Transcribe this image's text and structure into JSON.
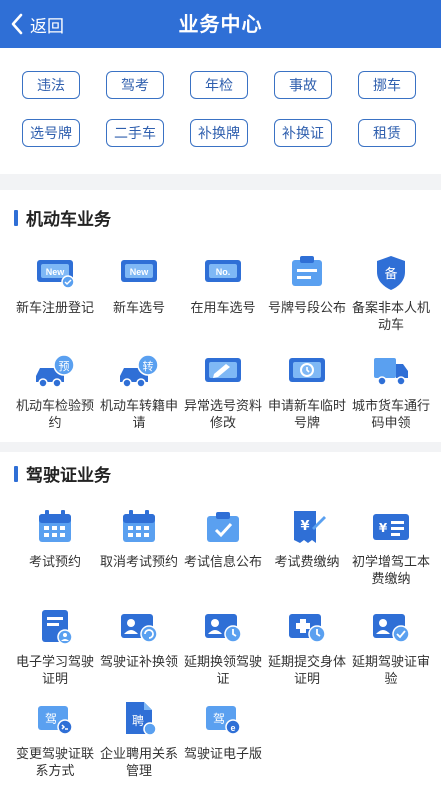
{
  "header": {
    "back_label": "返回",
    "title": "业务中心"
  },
  "filters": [
    "违法",
    "驾考",
    "年检",
    "事故",
    "挪车",
    "选号牌",
    "二手车",
    "补换牌",
    "补换证",
    "租赁"
  ],
  "sections": [
    {
      "title": "机动车业务",
      "items": [
        {
          "label": "新车注册登记",
          "icon": "new-plate-check-icon",
          "glyph": "New"
        },
        {
          "label": "新车选号",
          "icon": "new-plate-icon",
          "glyph": "New"
        },
        {
          "label": "在用车选号",
          "icon": "number-plate-icon",
          "glyph": "No."
        },
        {
          "label": "号牌号段公布",
          "icon": "notice-board-icon",
          "glyph": ""
        },
        {
          "label": "备案非本人机动车",
          "icon": "shield-record-icon",
          "glyph": "备"
        },
        {
          "label": "机动车检验预约",
          "icon": "car-inspection-icon",
          "glyph": "预"
        },
        {
          "label": "机动车转籍申请",
          "icon": "car-transfer-icon",
          "glyph": "转"
        },
        {
          "label": "异常选号资料修改",
          "icon": "plate-edit-icon",
          "glyph": ""
        },
        {
          "label": "申请新车临时号牌",
          "icon": "temp-plate-icon",
          "glyph": ""
        },
        {
          "label": "城市货车通行码申领",
          "icon": "truck-pass-icon",
          "glyph": ""
        }
      ]
    },
    {
      "title": "驾驶证业务",
      "items": [
        {
          "label": "考试预约",
          "icon": "calendar-icon",
          "glyph": ""
        },
        {
          "label": "取消考试预约",
          "icon": "calendar-cancel-icon",
          "glyph": ""
        },
        {
          "label": "考试信息公布",
          "icon": "exam-info-icon",
          "glyph": ""
        },
        {
          "label": "考试费缴纳",
          "icon": "fee-receipt-icon",
          "glyph": "¥"
        },
        {
          "label": "初学增驾工本费缴纳",
          "icon": "fee-card-icon",
          "glyph": "¥"
        },
        {
          "label": "电子学习驾驶证明",
          "icon": "study-certificate-icon",
          "glyph": ""
        },
        {
          "label": "驾驶证补换领",
          "icon": "license-renew-icon",
          "glyph": ""
        },
        {
          "label": "延期换领驾驶证",
          "icon": "license-delay-icon",
          "glyph": ""
        },
        {
          "label": "延期提交身体证明",
          "icon": "medical-delay-icon",
          "glyph": ""
        },
        {
          "label": "延期驾驶证审验",
          "icon": "license-review-icon",
          "glyph": ""
        },
        {
          "label": "变更驾驶证联系方式",
          "icon": "contact-change-icon",
          "glyph": "驾"
        },
        {
          "label": "企业聘用关系管理",
          "icon": "employment-icon",
          "glyph": "聘"
        },
        {
          "label": "驾驶证电子版",
          "icon": "e-license-icon",
          "glyph": "驾"
        }
      ]
    }
  ],
  "colors": {
    "brand": "#2f6fd6",
    "chip_border": "#3a72c4",
    "icon_light": "#5aa0f0",
    "icon_dark": "#2f6fd6",
    "bg": "#f2f3f5"
  }
}
